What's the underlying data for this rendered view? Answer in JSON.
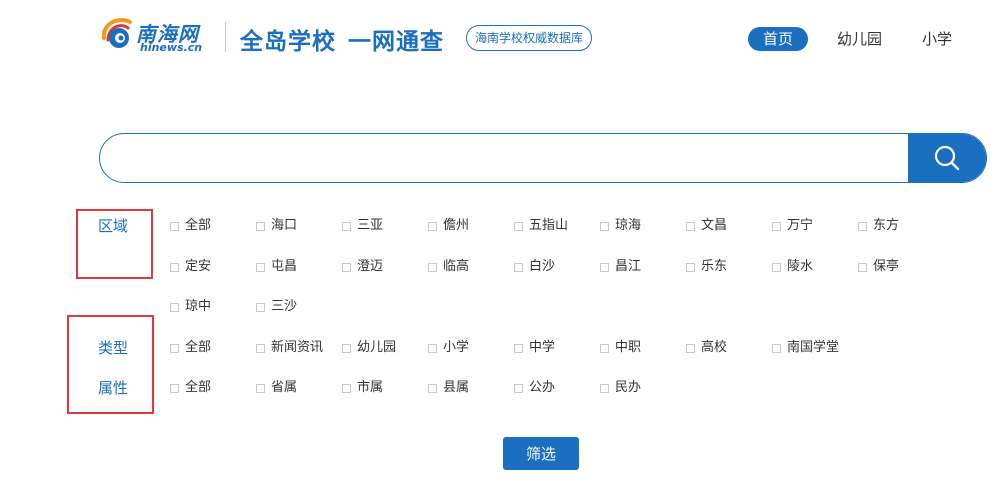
{
  "header": {
    "logo_cn": "南海网",
    "logo_en": "hinews.cn",
    "title_a": "全岛学校",
    "title_b": "一网通查",
    "badge": "海南学校权威数据库",
    "nav": [
      "首页",
      "幼儿园",
      "小学"
    ]
  },
  "search": {
    "value": "",
    "placeholder": ""
  },
  "filters": {
    "region": {
      "label": "区域",
      "options": [
        "全部",
        "海口",
        "三亚",
        "儋州",
        "五指山",
        "琼海",
        "文昌",
        "万宁",
        "东方",
        "定安",
        "屯昌",
        "澄迈",
        "临高",
        "白沙",
        "昌江",
        "乐东",
        "陵水",
        "保亭",
        "琼中",
        "三沙"
      ]
    },
    "type": {
      "label": "类型",
      "options": [
        "全部",
        "新闻资讯",
        "幼儿园",
        "小学",
        "中学",
        "中职",
        "高校",
        "南国学堂"
      ]
    },
    "attr": {
      "label": "属性",
      "options": [
        "全部",
        "省属",
        "市属",
        "县属",
        "公办",
        "民办"
      ]
    }
  },
  "action": {
    "filter_label": "筛选"
  },
  "colors": {
    "brand": "#1a6fc0",
    "highlight": "#e03b3b"
  }
}
